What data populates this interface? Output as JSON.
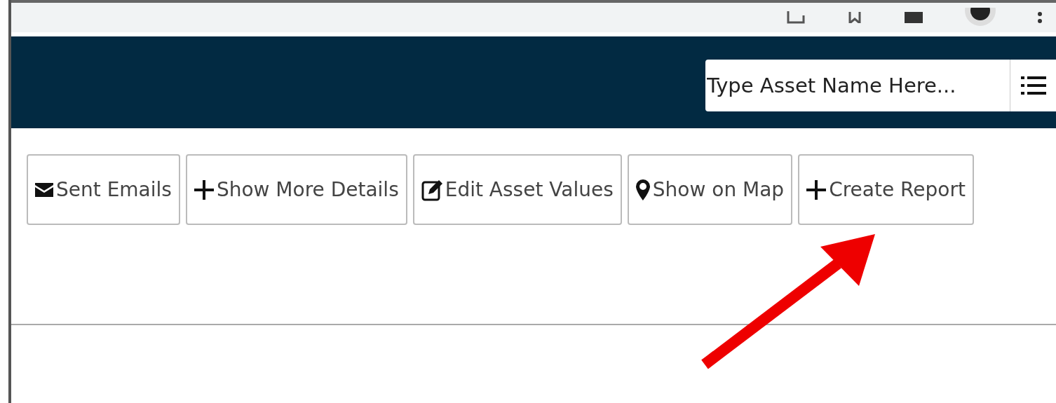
{
  "search": {
    "placeholder": "Type Asset Name Here..."
  },
  "actions": [
    {
      "label": "Sent Emails",
      "kind": "mail"
    },
    {
      "label": "Show More Details",
      "kind": "add"
    },
    {
      "label": "Edit Asset Values",
      "kind": "edit"
    },
    {
      "label": "Show on Map",
      "kind": "location"
    },
    {
      "label": "Create Report",
      "kind": "add"
    }
  ]
}
